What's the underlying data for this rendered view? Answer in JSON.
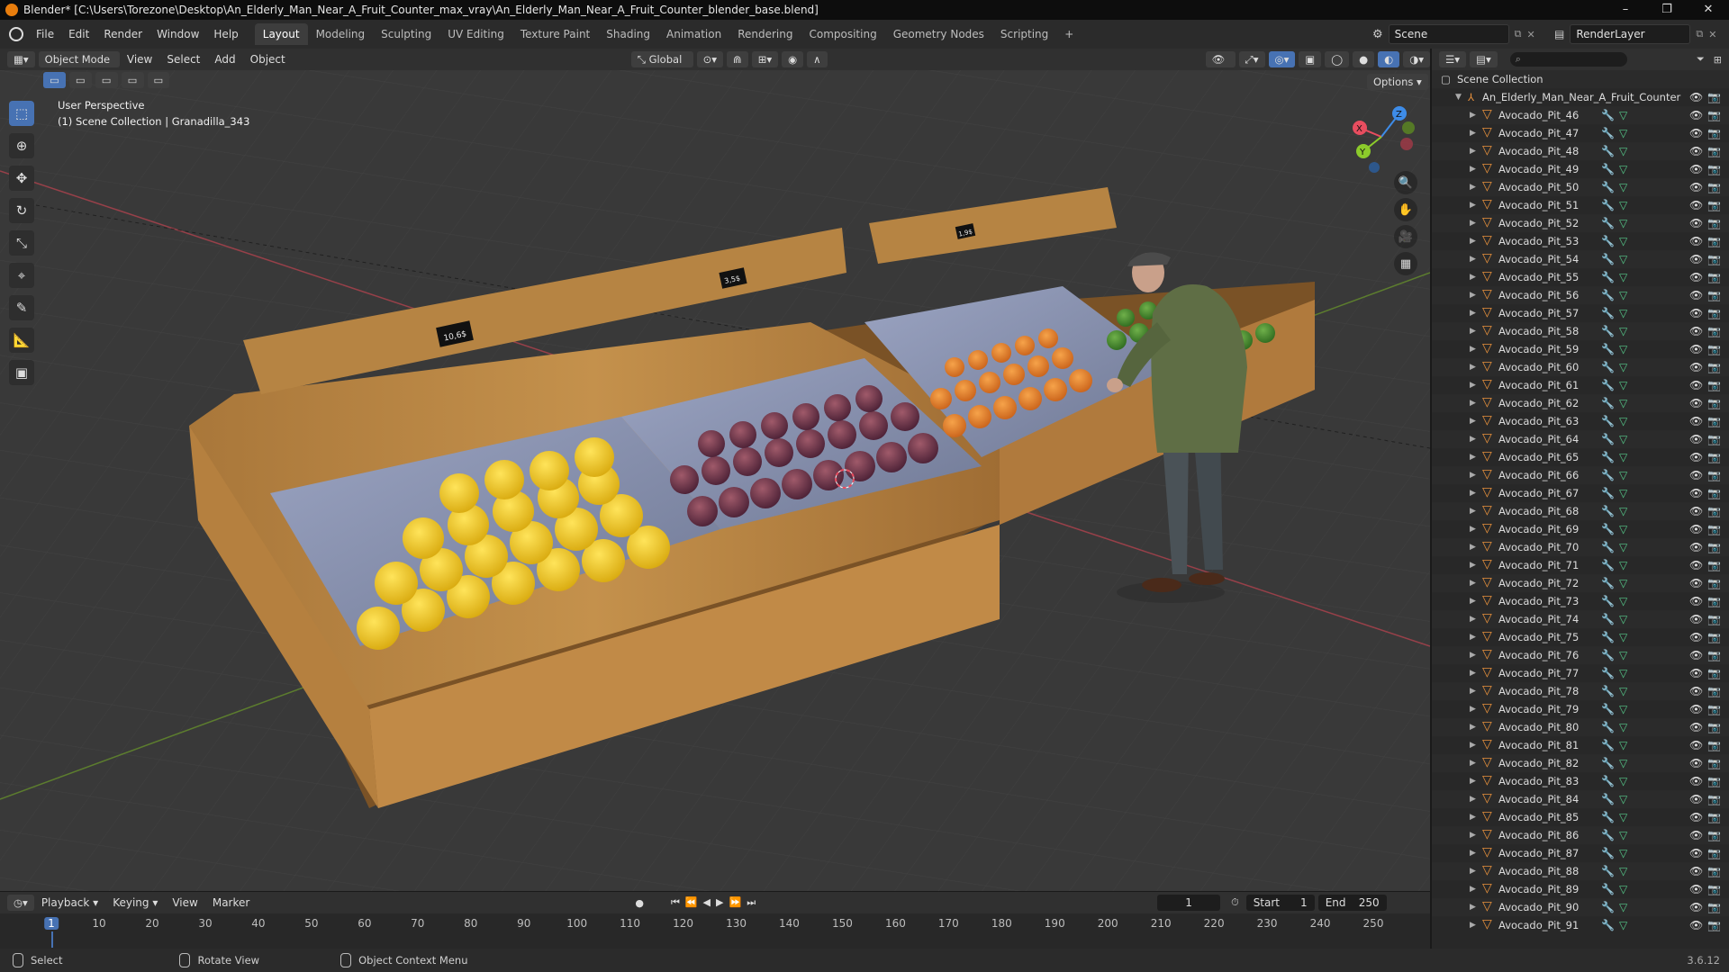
{
  "window": {
    "title": "Blender* [C:\\Users\\Torezone\\Desktop\\An_Elderly_Man_Near_A_Fruit_Counter_max_vray\\An_Elderly_Man_Near_A_Fruit_Counter_blender_base.blend]",
    "controls": [
      "–",
      "❐",
      "✕"
    ]
  },
  "menu": [
    "File",
    "Edit",
    "Render",
    "Window",
    "Help"
  ],
  "workspaces": [
    "Layout",
    "Modeling",
    "Sculpting",
    "UV Editing",
    "Texture Paint",
    "Shading",
    "Animation",
    "Rendering",
    "Compositing",
    "Geometry Nodes",
    "Scripting",
    "+"
  ],
  "active_workspace": "Layout",
  "scene": {
    "name": "Scene",
    "view_layer": "RenderLayer"
  },
  "viewport_header": {
    "mode": "Object Mode",
    "menus": [
      "View",
      "Select",
      "Add",
      "Object"
    ],
    "transform_orientation": "Global",
    "options_label": "Options"
  },
  "viewport": {
    "perspective": "User Perspective",
    "context": "(1) Scene Collection | Granadilla_343",
    "gizmo_axes": [
      "X",
      "Y",
      "Z"
    ],
    "price_tags": [
      "10,6$",
      "3,5$",
      "1,9$"
    ]
  },
  "tools": [
    "select-box-icon",
    "cursor-icon",
    "move-icon",
    "rotate-icon",
    "scale-icon",
    "transform-icon",
    "annotate-icon",
    "measure-icon",
    "add-cube-icon"
  ],
  "outliner": {
    "root": "Scene Collection",
    "collection": "An_Elderly_Man_Near_A_Fruit_Counter",
    "items": [
      "Avocado_Pit_46",
      "Avocado_Pit_47",
      "Avocado_Pit_48",
      "Avocado_Pit_49",
      "Avocado_Pit_50",
      "Avocado_Pit_51",
      "Avocado_Pit_52",
      "Avocado_Pit_53",
      "Avocado_Pit_54",
      "Avocado_Pit_55",
      "Avocado_Pit_56",
      "Avocado_Pit_57",
      "Avocado_Pit_58",
      "Avocado_Pit_59",
      "Avocado_Pit_60",
      "Avocado_Pit_61",
      "Avocado_Pit_62",
      "Avocado_Pit_63",
      "Avocado_Pit_64",
      "Avocado_Pit_65",
      "Avocado_Pit_66",
      "Avocado_Pit_67",
      "Avocado_Pit_68",
      "Avocado_Pit_69",
      "Avocado_Pit_70",
      "Avocado_Pit_71",
      "Avocado_Pit_72",
      "Avocado_Pit_73",
      "Avocado_Pit_74",
      "Avocado_Pit_75",
      "Avocado_Pit_76",
      "Avocado_Pit_77",
      "Avocado_Pit_78",
      "Avocado_Pit_79",
      "Avocado_Pit_80",
      "Avocado_Pit_81",
      "Avocado_Pit_82",
      "Avocado_Pit_83",
      "Avocado_Pit_84",
      "Avocado_Pit_85",
      "Avocado_Pit_86",
      "Avocado_Pit_87",
      "Avocado_Pit_88",
      "Avocado_Pit_89",
      "Avocado_Pit_90",
      "Avocado_Pit_91"
    ]
  },
  "timeline": {
    "menus": [
      "Playback",
      "Keying",
      "View",
      "Marker"
    ],
    "current_frame": "1",
    "start_label": "Start",
    "start": "1",
    "end_label": "End",
    "end": "250",
    "ticks": [
      "1",
      "10",
      "20",
      "30",
      "40",
      "50",
      "60",
      "70",
      "80",
      "90",
      "100",
      "110",
      "120",
      "130",
      "140",
      "150",
      "160",
      "170",
      "180",
      "190",
      "200",
      "210",
      "220",
      "230",
      "240",
      "250"
    ]
  },
  "status": {
    "left": "Select",
    "middle": "Rotate View",
    "right": "Object Context Menu",
    "version": "3.6.12"
  },
  "colors": {
    "accent": "#4772b3",
    "mesh_icon": "#e8913c",
    "x_axis": "#e84d5f",
    "y_axis": "#8ccb2b",
    "z_axis": "#3e8ce8"
  }
}
